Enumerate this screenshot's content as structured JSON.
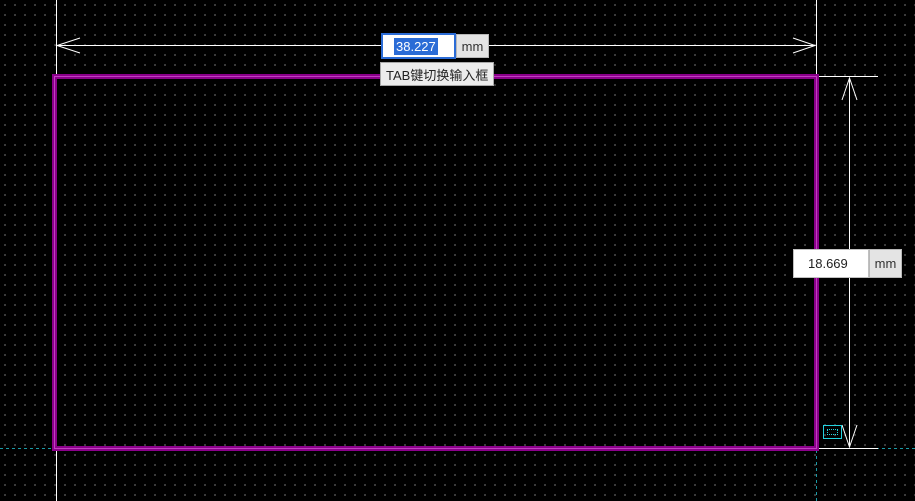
{
  "width_dimension": {
    "value": "38.227",
    "unit": "mm"
  },
  "height_dimension": {
    "value": "18.669",
    "unit": "mm"
  },
  "tooltip": {
    "text": "TAB键切换输入框"
  },
  "colors": {
    "background": "#000000",
    "grid_dot": "#4a4a4a",
    "outline": "#8b008b",
    "outline_inner": "#c040c0",
    "dimension_line": "#ffffff",
    "crosshair": "#1a9aa6",
    "selection": "#2b6cd6",
    "snap_marker": "#22d3e0"
  },
  "icons": {
    "snap_marker": "rectangle-snap-icon"
  }
}
